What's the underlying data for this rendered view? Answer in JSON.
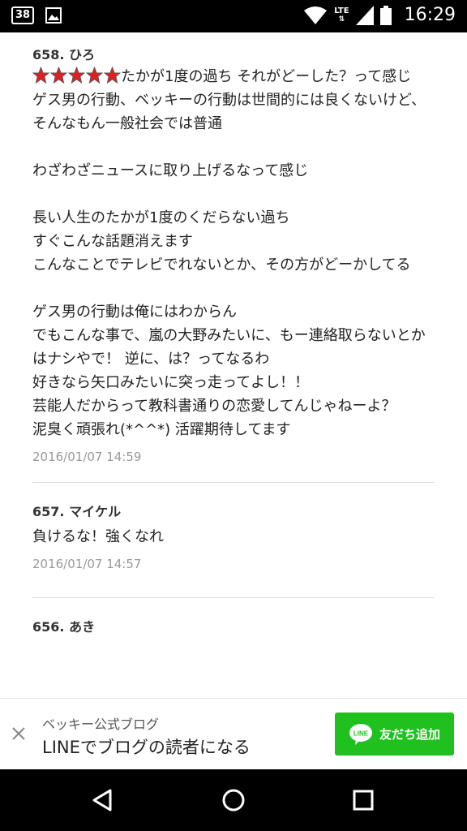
{
  "status_bar": {
    "notification_count": "38",
    "network": "LTE",
    "time": "16:29"
  },
  "comments": [
    {
      "number": "658.",
      "user": "ひろ",
      "rating_stars": 5,
      "body": "たかが1度の過ち それがどーした？って感じ\nゲス男の行動、ベッキーの行動は世間的には良くないけど、そんなもん一般社会では普通\n\nわざわざニュースに取り上げるなって感じ\n\n長い人生のたかが1度のくだらない過ち\nすぐこんな話題消えます\nこんなことでテレビでれないとか、その方がどーかしてる\n\nゲス男の行動は俺にはわからん\nでもこんな事で、嵐の大野みたいに、もー連絡取らないとかはナシやで！ 逆に、は？ってなるわ\n好きなら矢口みたいに突っ走ってよし！！\n芸能人だからって教科書通りの恋愛してんじゃねーよ？\n泥臭く頑張れ(*^^*) 活躍期待してます",
      "date": "2016/01/07 14:59"
    },
    {
      "number": "657.",
      "user": "マイケル",
      "body": "負けるな！強くなれ",
      "date": "2016/01/07 14:57"
    },
    {
      "number": "656.",
      "user": "あき"
    }
  ],
  "banner": {
    "subtitle": "ベッキー公式ブログ",
    "title": "LINEでブログの読者になる",
    "button_label": "友だち追加",
    "button_color": "#1ec11e"
  },
  "icons": {
    "status": [
      "notification-badge-icon",
      "image-icon",
      "wifi-icon",
      "signal-icon",
      "battery-icon"
    ],
    "nav": [
      "back-icon",
      "home-icon",
      "recents-icon"
    ],
    "banner": [
      "close-icon",
      "line-logo-icon"
    ]
  }
}
